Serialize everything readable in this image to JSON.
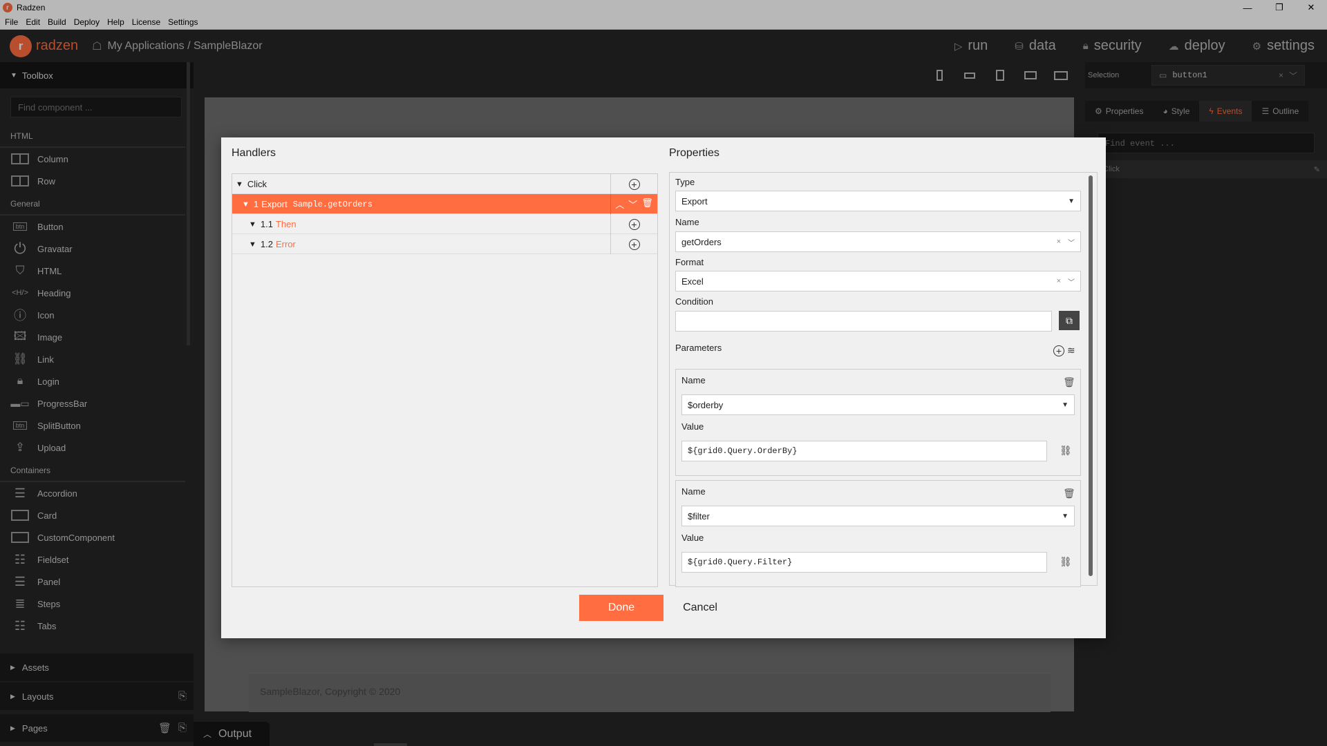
{
  "window": {
    "title": "Radzen",
    "logo_letter": "r",
    "controls": [
      "—",
      "❐",
      "✕"
    ]
  },
  "menu": [
    "File",
    "Edit",
    "Build",
    "Deploy",
    "Help",
    "License",
    "Settings"
  ],
  "header": {
    "logo_letter": "r",
    "logo_text": "radzen",
    "breadcrumb": "My Applications / SampleBlazor",
    "nav": [
      {
        "label": "run",
        "icon": "play-icon"
      },
      {
        "label": "data",
        "icon": "database-icon"
      },
      {
        "label": "security",
        "icon": "lock-icon"
      },
      {
        "label": "deploy",
        "icon": "cloud-icon"
      },
      {
        "label": "settings",
        "icon": "gear-icon"
      }
    ]
  },
  "toolbox": {
    "title": "Toolbox",
    "search_placeholder": "Find component ...",
    "sections": {
      "html": "HTML",
      "general": "General",
      "containers": "Containers"
    },
    "html_items": [
      "Column",
      "Row"
    ],
    "general_items": [
      "Button",
      "Gravatar",
      "HTML",
      "Heading",
      "Icon",
      "Image",
      "Link",
      "Login",
      "ProgressBar",
      "SplitButton",
      "Upload"
    ],
    "container_items": [
      "Accordion",
      "Card",
      "CustomComponent",
      "Fieldset",
      "Panel",
      "Steps",
      "Tabs"
    ],
    "bottom": [
      "Assets",
      "Layouts",
      "Pages"
    ]
  },
  "center": {
    "footer_text": "SampleBlazor, Copyright © 2020",
    "output_label": "Output"
  },
  "right_panel": {
    "selection_label": "Selection",
    "selection_value": "button1",
    "tabs": [
      "Properties",
      "Style",
      "Events",
      "Outline"
    ],
    "active_tab": "Events",
    "find_event_placeholder": "Find event ...",
    "event_name": "Click"
  },
  "dialog": {
    "handlers_title": "Handlers",
    "properties_title": "Properties",
    "handlers": {
      "root": "Click",
      "selected_num": "1",
      "selected_type": "Export",
      "selected_target": "Sample.getOrders",
      "then_num": "1.1",
      "then_label": "Then",
      "error_num": "1.2",
      "error_label": "Error"
    },
    "props": {
      "type_label": "Type",
      "type_value": "Export",
      "name_label": "Name",
      "name_value": "getOrders",
      "format_label": "Format",
      "format_value": "Excel",
      "condition_label": "Condition",
      "condition_value": "",
      "parameters_label": "Parameters",
      "params": [
        {
          "name_label": "Name",
          "name_value": "$orderby",
          "value_label": "Value",
          "value": "${grid0.Query.OrderBy}"
        },
        {
          "name_label": "Name",
          "name_value": "$filter",
          "value_label": "Value",
          "value": "${grid0.Query.Filter}"
        }
      ]
    },
    "done_label": "Done",
    "cancel_label": "Cancel"
  },
  "colors": {
    "accent": "#ff6d41",
    "dark_bg": "#262626",
    "dialog_bg": "#f0f0f0"
  }
}
